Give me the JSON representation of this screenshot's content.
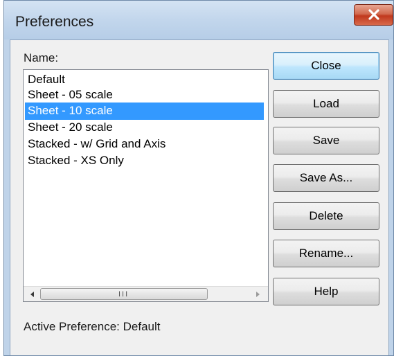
{
  "window": {
    "title": "Preferences",
    "close_icon": "close-x-icon"
  },
  "labels": {
    "name": "Name:",
    "active_preference": "Active Preference: Default"
  },
  "list": {
    "items": [
      {
        "label": "Default",
        "selected": false
      },
      {
        "label": "Sheet - 05 scale",
        "selected": false
      },
      {
        "label": "Sheet - 10 scale",
        "selected": true
      },
      {
        "label": "Sheet - 20 scale",
        "selected": false
      },
      {
        "label": "Stacked - w/ Grid and Axis",
        "selected": false
      },
      {
        "label": "Stacked - XS Only",
        "selected": false
      }
    ],
    "scrollbar": {
      "left_icon": "scroll-left-arrow-icon",
      "right_icon": "scroll-right-arrow-icon",
      "grip": "III"
    }
  },
  "buttons": {
    "close": "Close",
    "load": "Load",
    "save": "Save",
    "save_as": "Save As...",
    "delete": "Delete",
    "rename": "Rename...",
    "help": "Help"
  },
  "colors": {
    "selection": "#3399ff",
    "title_close": "#c0391e"
  }
}
